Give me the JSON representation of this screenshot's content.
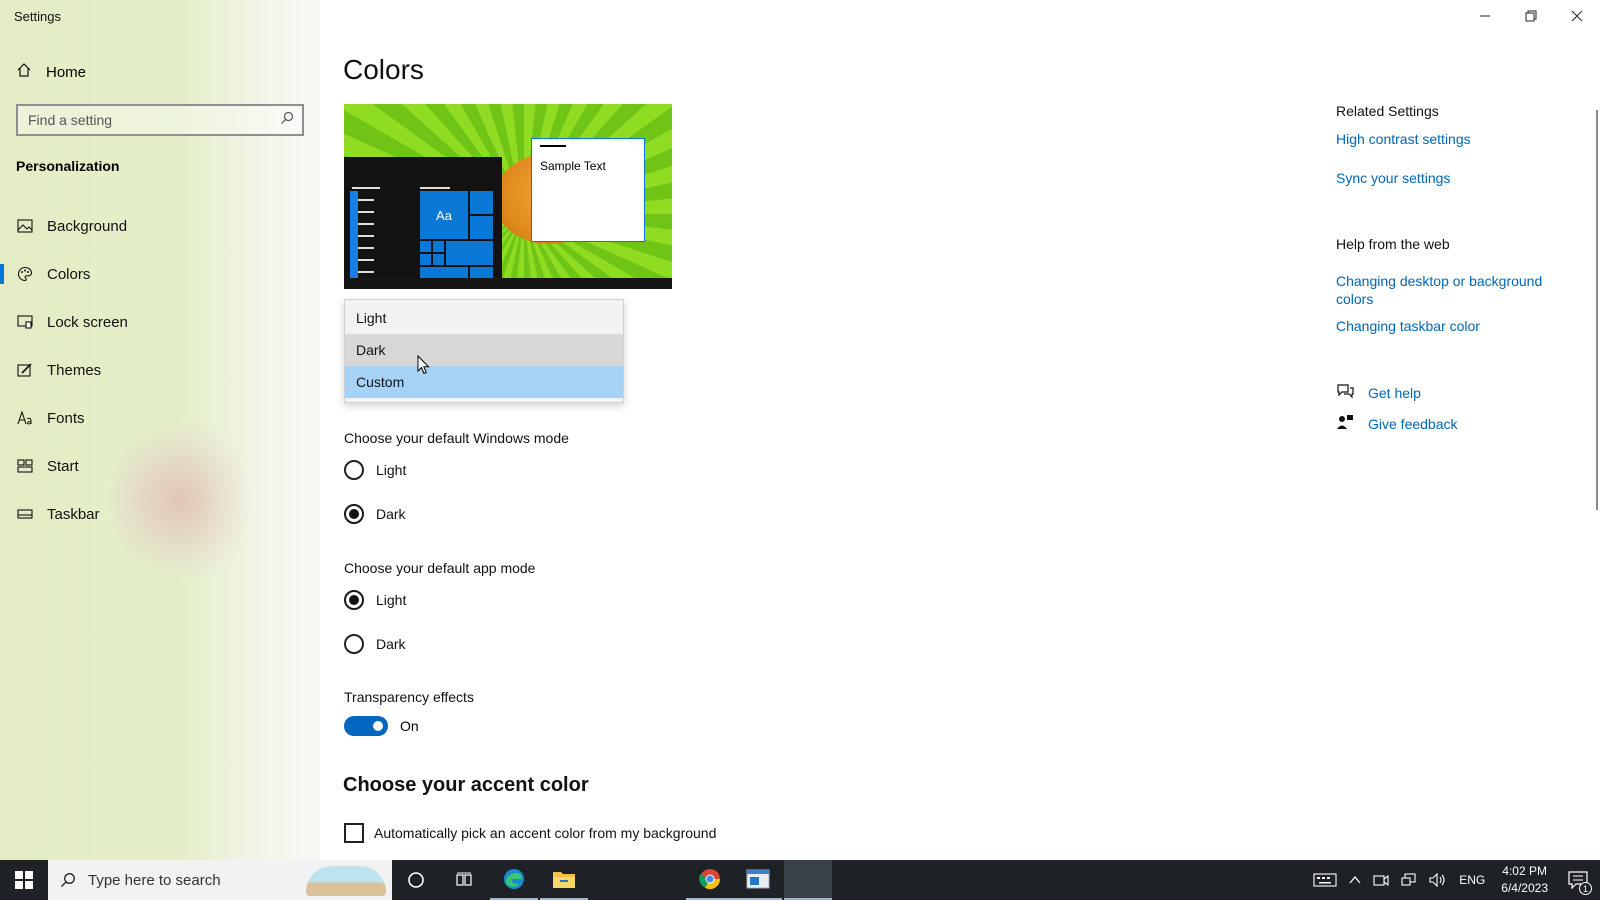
{
  "window": {
    "title": "Settings"
  },
  "sidebar": {
    "home_label": "Home",
    "search_placeholder": "Find a setting",
    "section_title": "Personalization",
    "items": [
      {
        "label": "Background",
        "icon": "image-icon",
        "active": false
      },
      {
        "label": "Colors",
        "icon": "palette-icon",
        "active": true
      },
      {
        "label": "Lock screen",
        "icon": "lock-screen-icon",
        "active": false
      },
      {
        "label": "Themes",
        "icon": "brush-icon",
        "active": false
      },
      {
        "label": "Fonts",
        "icon": "font-icon",
        "active": false
      },
      {
        "label": "Start",
        "icon": "start-icon",
        "active": false
      },
      {
        "label": "Taskbar",
        "icon": "taskbar-icon",
        "active": false
      }
    ]
  },
  "main": {
    "title": "Colors",
    "preview": {
      "tile_text": "Aa",
      "sample_text": "Sample Text"
    },
    "color_dropdown": {
      "options": [
        "Light",
        "Dark",
        "Custom"
      ],
      "hovered": "Dark",
      "selected": "Custom"
    },
    "windows_mode": {
      "label": "Choose your default Windows mode",
      "options": [
        "Light",
        "Dark"
      ],
      "selected": "Dark"
    },
    "app_mode": {
      "label": "Choose your default app mode",
      "options": [
        "Light",
        "Dark"
      ],
      "selected": "Light"
    },
    "transparency": {
      "label": "Transparency effects",
      "state": "On"
    },
    "accent": {
      "title": "Choose your accent color",
      "auto_pick_label": "Automatically pick an accent color from my background",
      "auto_pick_checked": false
    }
  },
  "right_rail": {
    "related_heading": "Related Settings",
    "related_links": [
      "High contrast settings",
      "Sync your settings"
    ],
    "help_heading": "Help from the web",
    "help_links": [
      "Changing desktop or background colors",
      "Changing taskbar color"
    ],
    "get_help": "Get help",
    "give_feedback": "Give feedback"
  },
  "taskbar": {
    "search_placeholder": "Type here to search",
    "apps": [
      "cortana-icon",
      "task-view-icon",
      "edge-icon",
      "file-explorer-icon",
      "chrome-icon",
      "app-window-icon",
      "settings-app-icon"
    ],
    "language": "ENG",
    "time": "4:02 PM",
    "date": "6/4/2023",
    "notification_count": "1"
  },
  "colors": {
    "accent": "#0078d7",
    "link": "#0067b8",
    "taskbar": "#1e2226"
  }
}
